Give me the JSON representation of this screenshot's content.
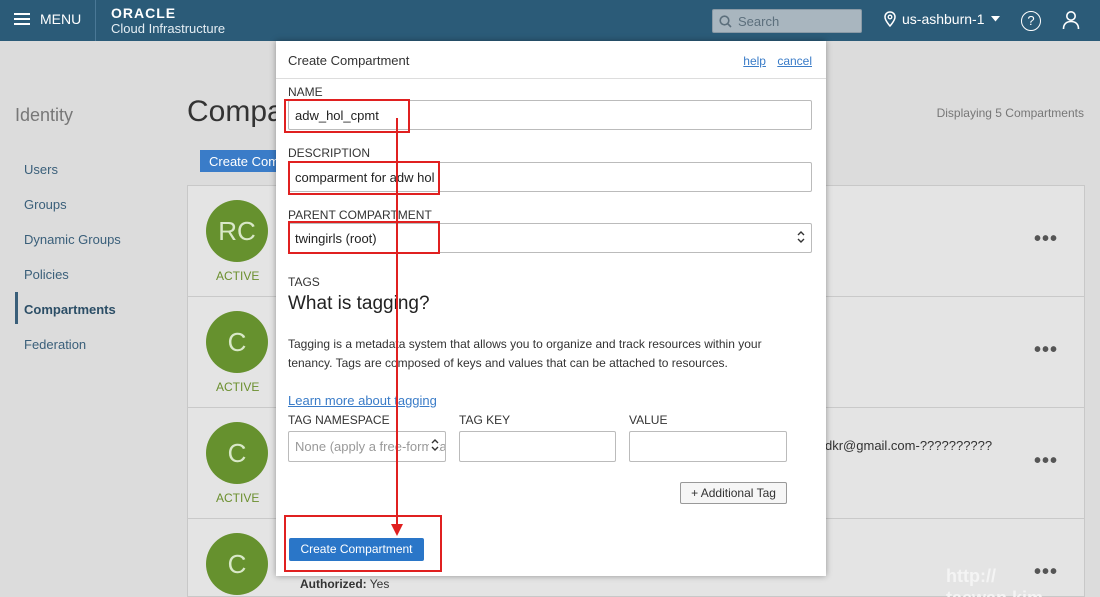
{
  "topbar": {
    "menu_label": "MENU",
    "brand_line1": "ORACLE",
    "brand_line2": "Cloud Infrastructure",
    "search_placeholder": "Search",
    "region": "us-ashburn-1",
    "help_glyph": "?"
  },
  "sidebar": {
    "heading": "Identity",
    "items": [
      {
        "label": "Users"
      },
      {
        "label": "Groups"
      },
      {
        "label": "Dynamic Groups"
      },
      {
        "label": "Policies"
      },
      {
        "label": "Compartments",
        "active": true
      },
      {
        "label": "Federation"
      }
    ]
  },
  "main": {
    "title": "Compartments",
    "create_button": "Create Compartment",
    "displaying": "Displaying 5 Compartments",
    "rows": [
      {
        "initials": "RC",
        "status": "ACTIVE"
      },
      {
        "initials": "C",
        "status": "ACTIVE"
      },
      {
        "initials": "C",
        "status": "ACTIVE",
        "detail": "dkr@gmail.com-??????????"
      },
      {
        "initials": "C",
        "authorized_label": "Authorized:",
        "authorized_value": "Yes"
      }
    ],
    "row_menu": "•••",
    "watermark": "http://\ntaewan.kim"
  },
  "modal": {
    "title": "Create Compartment",
    "help_link": "help",
    "cancel_link": "cancel",
    "name_label": "NAME",
    "name_value": "adw_hol_cpmt",
    "description_label": "DESCRIPTION",
    "description_value": "comparment for adw hol",
    "parent_label": "PARENT COMPARTMENT",
    "parent_value": "twingirls (root)",
    "tags_label": "TAGS",
    "tags_heading": "What is tagging?",
    "tags_description": "Tagging is a metadata system that allows you to organize and track resources within your tenancy. Tags are composed of keys and values that can be attached to resources.",
    "learn_more": "Learn more about tagging",
    "tag_namespace_label": "TAG NAMESPACE",
    "tag_namespace_value": "None (apply a free-form tag)",
    "tag_key_label": "TAG KEY",
    "value_label": "VALUE",
    "add_tag_button": "+ Additional Tag",
    "submit_button": "Create Compartment"
  },
  "colors": {
    "topbar": "#2b5b78",
    "accent": "#2a76c8",
    "avatar": "#66912e",
    "annotation": "#e02020"
  }
}
